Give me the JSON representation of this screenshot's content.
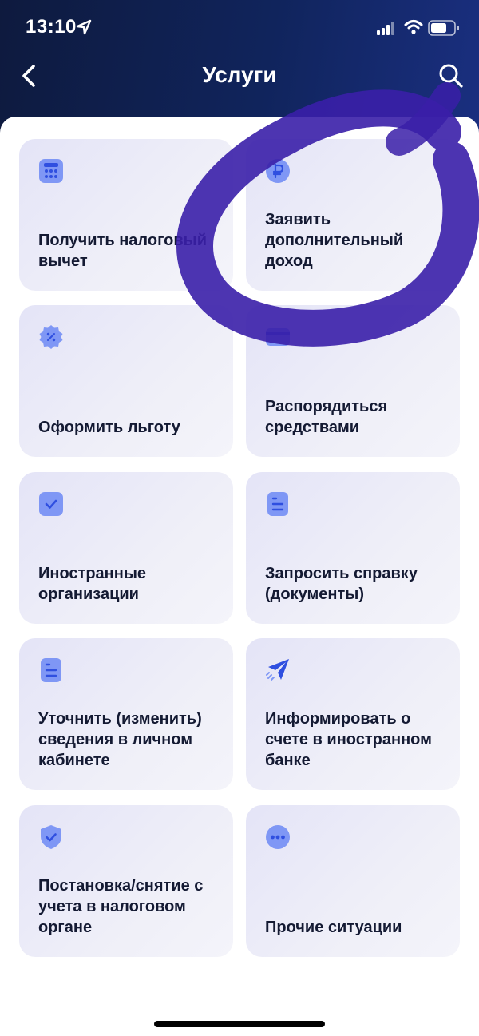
{
  "status_bar": {
    "time": "13:10"
  },
  "nav": {
    "title": "Услуги"
  },
  "services": [
    {
      "label": "Получить налоговый вычет",
      "icon": "calculator-icon"
    },
    {
      "label": "Заявить дополнительный доход",
      "icon": "ruble-coin-icon"
    },
    {
      "label": "Оформить льготу",
      "icon": "discount-badge-icon"
    },
    {
      "label": "Распорядиться средствами",
      "icon": "card-icon"
    },
    {
      "label": "Иностранные организации",
      "icon": "checkbox-icon"
    },
    {
      "label": "Запросить справку (документы)",
      "icon": "document-icon"
    },
    {
      "label": "Уточнить (изменить) сведения в личном кабинете",
      "icon": "document-icon"
    },
    {
      "label": "Информировать о счете в иностранном банке",
      "icon": "paper-plane-icon"
    },
    {
      "label": "Постановка/снятие с учета в налоговом органе",
      "icon": "shield-check-icon"
    },
    {
      "label": "Прочие ситуации",
      "icon": "more-dots-icon"
    }
  ],
  "colors": {
    "accent": "#4f6df5",
    "icon_bg": "#7f97f5",
    "header_dark": "#0e1a3e",
    "scribble": "#3a1fa8"
  }
}
